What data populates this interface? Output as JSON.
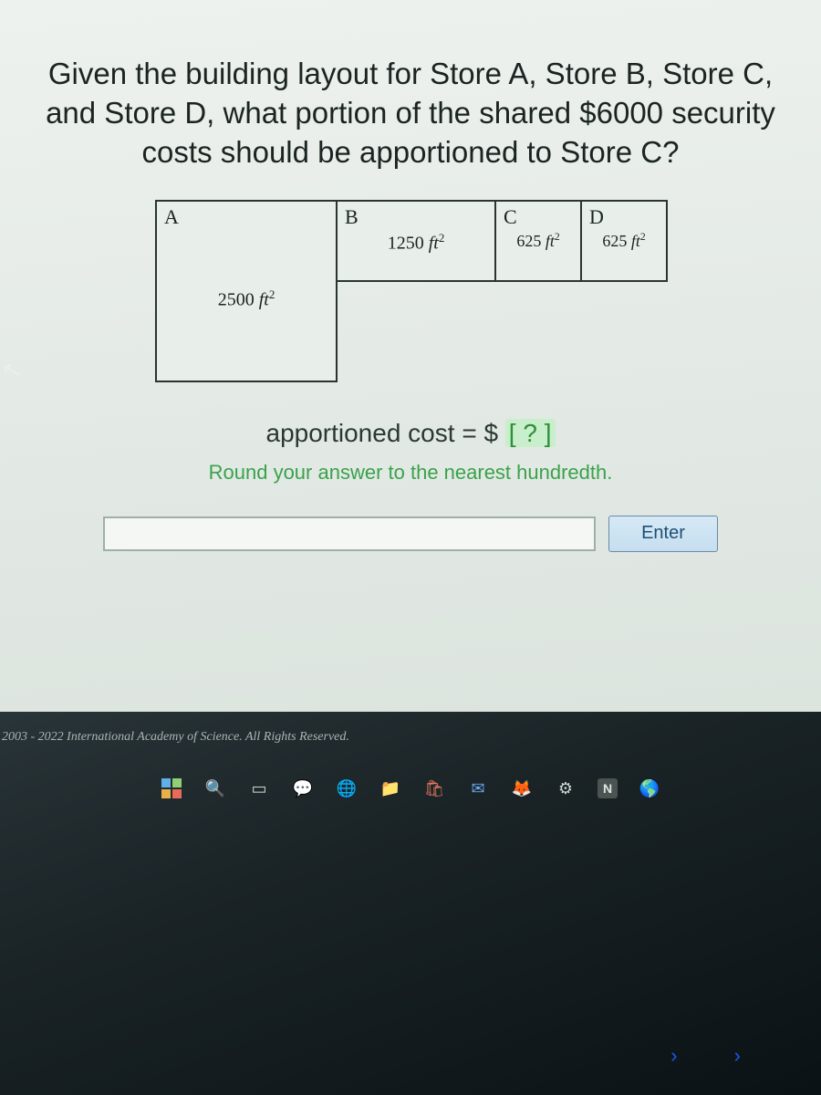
{
  "question": "Given the building layout for Store A, Store B, Store C, and Store D, what portion of the shared $6000 security costs should be apportioned to Store C?",
  "stores": {
    "A": {
      "label": "A",
      "area": "2500 ft²"
    },
    "B": {
      "label": "B",
      "area": "1250 ft²"
    },
    "C": {
      "label": "C",
      "area": "625 ft²"
    },
    "D": {
      "label": "D",
      "area": "625 ft²"
    }
  },
  "cost_line_prefix": "apportioned cost = $ ",
  "cost_line_placeholder": "[ ? ]",
  "round_instruction": "Round your answer to the nearest hundredth.",
  "enter_label": "Enter",
  "answer_value": "",
  "copyright": "2003 - 2022 International Academy of Science. All Rights Reserved.",
  "taskbar": {
    "start": "start-icon",
    "search": "search-icon",
    "taskview": "task-view-icon",
    "chat": "chat-icon",
    "edge": "edge-icon",
    "explorer": "file-explorer-icon",
    "store": "ms-store-icon",
    "mail": "mail-icon",
    "firefox": "firefox-icon",
    "settings": "settings-icon",
    "notion": "notion-icon",
    "earth": "earth-icon"
  }
}
